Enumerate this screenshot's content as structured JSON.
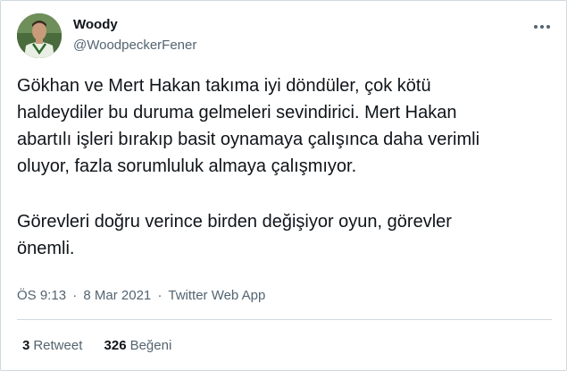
{
  "user": {
    "name": "Woody",
    "handle": "@WoodpeckerFener"
  },
  "icons": {
    "more": "more-horizontal-icon",
    "avatar": "profile-photo"
  },
  "tweet": {
    "paragraph1": "Gökhan ve Mert Hakan takıma iyi döndüler, çok kötü\nhaldeydiler bu duruma gelmeleri sevindirici. Mert Hakan\nabartılı işleri bırakıp basit oynamaya çalışınca daha verimli\noluyor, fazla sorumluluk almaya çalışmıyor.",
    "paragraph2": "Görevleri doğru verince birden değişiyor oyun, görevler\nönemli."
  },
  "meta": {
    "time": "ÖS 9:13",
    "separator": "·",
    "date": "8 Mar 2021",
    "source": "Twitter Web App"
  },
  "stats": {
    "retweets_count": "3",
    "retweets_label": "Retweet",
    "likes_count": "326",
    "likes_label": "Beğeni"
  },
  "colors": {
    "text": "#0f1419",
    "secondary": "#536471",
    "border": "#cfd9de"
  }
}
